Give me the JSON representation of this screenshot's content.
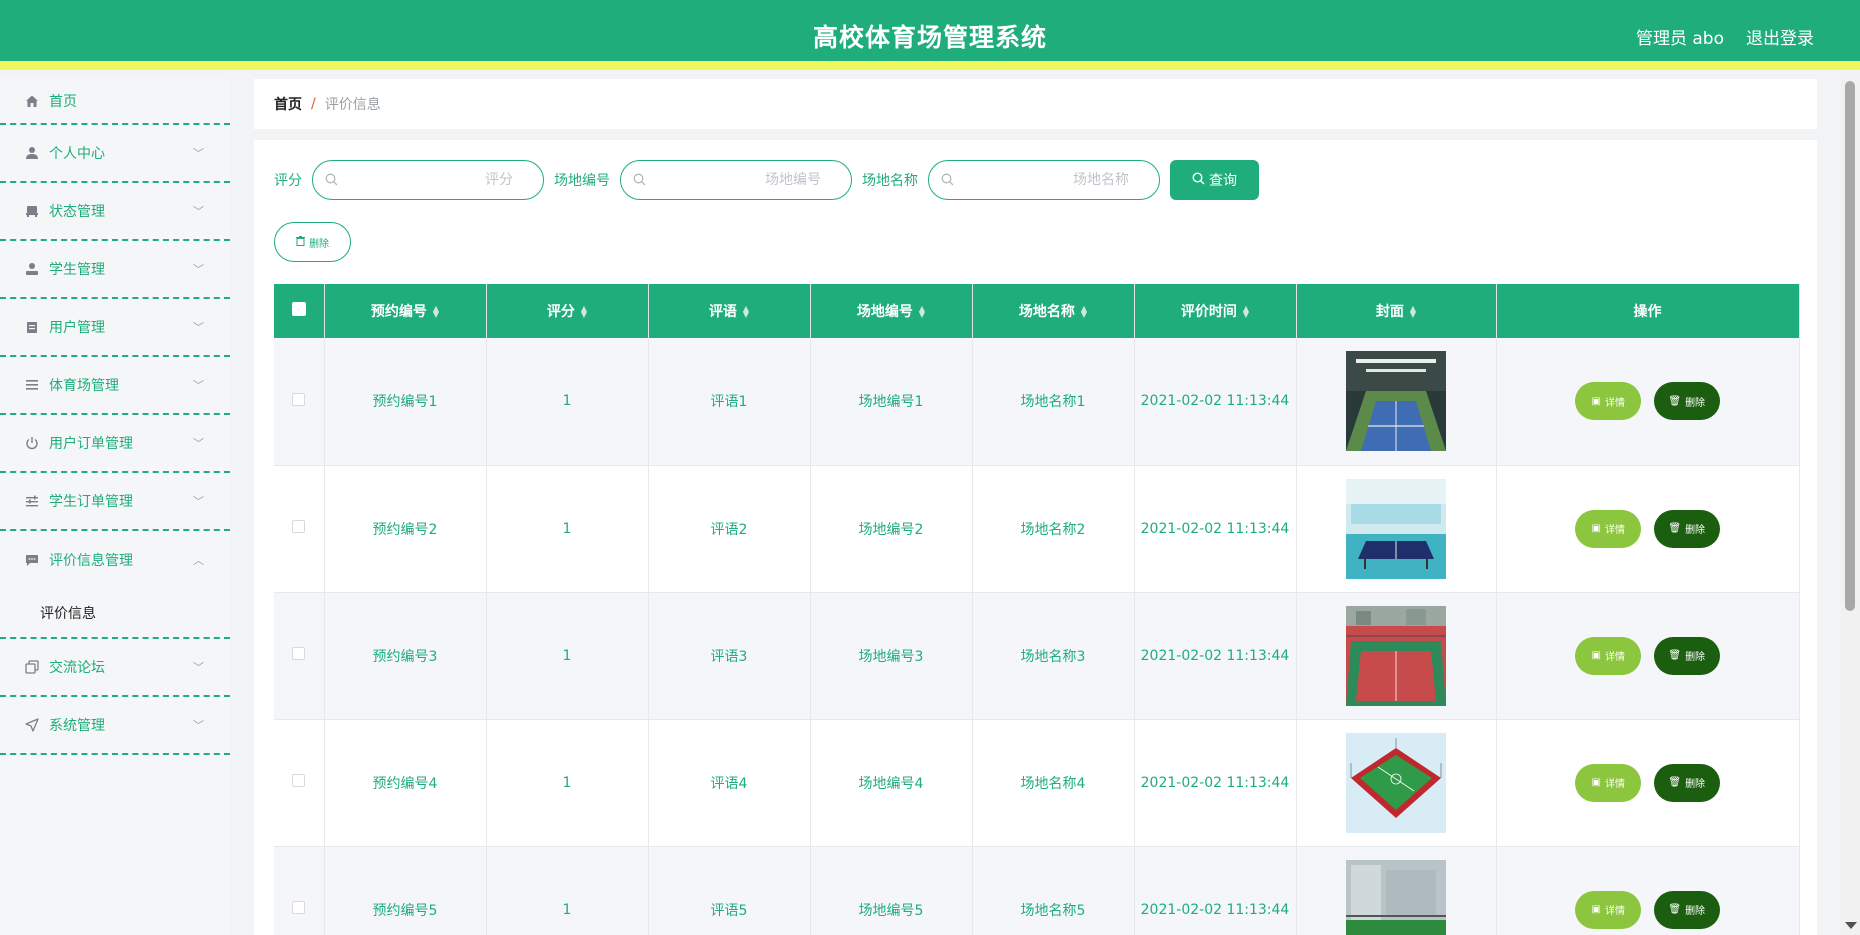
{
  "header": {
    "title": "高校体育场管理系统",
    "user": "管理员 abo",
    "logout": "退出登录"
  },
  "sidebar": {
    "items": [
      {
        "label": "首页",
        "icon": "home-icon",
        "expandable": false
      },
      {
        "label": "个人中心",
        "icon": "person-icon",
        "expandable": true
      },
      {
        "label": "状态管理",
        "icon": "seat-icon",
        "expandable": true
      },
      {
        "label": "学生管理",
        "icon": "student-icon",
        "expandable": true
      },
      {
        "label": "用户管理",
        "icon": "clipboard-icon",
        "expandable": true
      },
      {
        "label": "体育场管理",
        "icon": "list-icon",
        "expandable": true
      },
      {
        "label": "用户订单管理",
        "icon": "power-icon",
        "expandable": true
      },
      {
        "label": "学生订单管理",
        "icon": "sliders-icon",
        "expandable": true
      },
      {
        "label": "评价信息管理",
        "icon": "comment-icon",
        "expandable": true,
        "expanded": true,
        "submenu": "评价信息"
      },
      {
        "label": "交流论坛",
        "icon": "copy-icon",
        "expandable": true
      },
      {
        "label": "系统管理",
        "icon": "send-icon",
        "expandable": true
      }
    ]
  },
  "breadcrumb": {
    "home": "首页",
    "separator": "/",
    "current": "评价信息"
  },
  "search": {
    "fields": [
      {
        "label": "评分",
        "placeholder": "评分"
      },
      {
        "label": "场地编号",
        "placeholder": "场地编号"
      },
      {
        "label": "场地名称",
        "placeholder": "场地名称"
      }
    ],
    "query_label": "查询"
  },
  "toolbar": {
    "delete_label": "删除"
  },
  "table": {
    "columns": [
      "预约编号",
      "评分",
      "评语",
      "场地编号",
      "场地名称",
      "评价时间",
      "封面",
      "操作"
    ],
    "rows": [
      {
        "booking_no": "预约编号1",
        "score": "1",
        "comment": "评语1",
        "venue_no": "场地编号1",
        "venue_name": "场地名称1",
        "time": "2021-02-02 11:13:44",
        "cover": "badminton-court-image"
      },
      {
        "booking_no": "预约编号2",
        "score": "1",
        "comment": "评语2",
        "venue_no": "场地编号2",
        "venue_name": "场地名称2",
        "time": "2021-02-02 11:13:44",
        "cover": "table-tennis-room-image"
      },
      {
        "booking_no": "预约编号3",
        "score": "1",
        "comment": "评语3",
        "venue_no": "场地编号3",
        "venue_name": "场地名称3",
        "time": "2021-02-02 11:13:44",
        "cover": "outdoor-court-image"
      },
      {
        "booking_no": "预约编号4",
        "score": "1",
        "comment": "评语4",
        "venue_no": "场地编号4",
        "venue_name": "场地名称4",
        "time": "2021-02-02 11:13:44",
        "cover": "futsal-court-image"
      },
      {
        "booking_no": "预约编号5",
        "score": "1",
        "comment": "评语5",
        "venue_no": "场地编号5",
        "venue_name": "场地名称5",
        "time": "2021-02-02 11:13:44",
        "cover": "rooftop-field-image"
      }
    ],
    "detail_label": "详情",
    "delete_label": "删除"
  },
  "colors": {
    "primary": "#1fad7b",
    "accent_strip": "#eef75d",
    "detail_btn": "#8cc63f",
    "delete_btn": "#1b5e0f"
  }
}
